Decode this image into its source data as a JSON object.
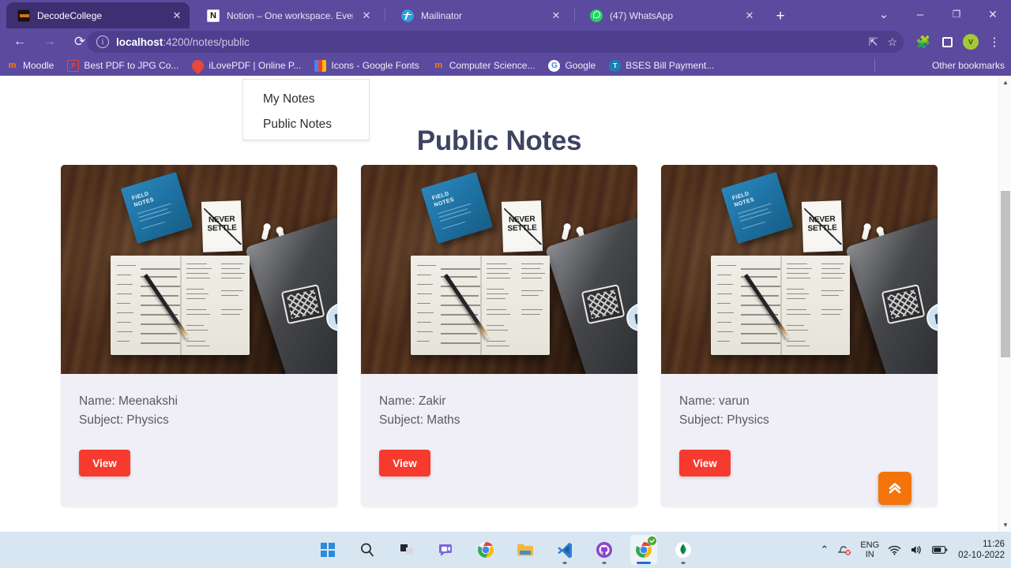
{
  "browser": {
    "tabs": [
      {
        "title": "DecodeCollege",
        "active": true,
        "favicon": "decodecollege-icon",
        "close_label": "✕"
      },
      {
        "title": "Notion – One workspace. Every t",
        "active": false,
        "favicon": "notion-icon",
        "close_label": "✕"
      },
      {
        "title": "Mailinator",
        "active": false,
        "favicon": "mailinator-icon",
        "close_label": "✕"
      },
      {
        "title": "(47) WhatsApp",
        "active": false,
        "favicon": "whatsapp-icon",
        "close_label": "✕"
      }
    ],
    "new_tab_label": "+",
    "window_controls": {
      "tab_search": "⌄",
      "minimize": "–",
      "maximize": "❐",
      "close": "✕"
    },
    "nav": {
      "back": "←",
      "forward": "→",
      "reload": "⟳"
    },
    "omnibox": {
      "info_label": "i",
      "url_host": "localhost",
      "url_path": ":4200/notes/public",
      "full_url": "localhost:4200/notes/public",
      "share_icon": "share-icon",
      "bookmark_icon": "star-icon"
    },
    "toolbar_icons": {
      "extensions": "puzzle-icon",
      "side_panel": "side-panel-icon",
      "profile_initial": "v",
      "menu": "⋮"
    },
    "bookmarks": [
      {
        "label": "Moodle",
        "icon": "moodle-icon",
        "color": "#f98012"
      },
      {
        "label": "Best PDF to JPG Co...",
        "icon": "pdf-icon",
        "color": "#e8483c"
      },
      {
        "label": "iLovePDF | Online P...",
        "icon": "ilovepdf-icon",
        "color": "#e8483c"
      },
      {
        "label": "Icons - Google Fonts",
        "icon": "google-fonts-icon",
        "color": "#fbbc04"
      },
      {
        "label": "Computer Science...",
        "icon": "moodle-icon",
        "color": "#f98012"
      },
      {
        "label": "Google",
        "icon": "google-icon",
        "color": "#4285f4"
      },
      {
        "label": "BSES Bill Payment...",
        "icon": "bses-icon",
        "color": "#1a7fb5"
      }
    ],
    "other_bookmarks": {
      "label": "Other bookmarks",
      "icon": "folder-icon"
    }
  },
  "page": {
    "title": "Public Notes",
    "dropdown": {
      "items": [
        {
          "label": "My Notes"
        },
        {
          "label": "Public Notes"
        }
      ]
    },
    "notes": [
      {
        "name_label": "Name: Meenakshi",
        "subject_label": "Subject: Physics",
        "button_label": "View",
        "image_alt": "desk-notebook-photo"
      },
      {
        "name_label": "Name: Zakir",
        "subject_label": "Subject: Maths",
        "button_label": "View",
        "image_alt": "desk-notebook-photo"
      },
      {
        "name_label": "Name: varun",
        "subject_label": "Subject: Physics",
        "button_label": "View",
        "image_alt": "desk-notebook-photo"
      }
    ],
    "photo_text": {
      "field_notes": "FIELD\nNOTES",
      "never_settle": "NEVER\nSETTLE"
    },
    "scroll_top_button": {
      "icon": "double-chevron-up-icon",
      "color": "#f2740b"
    },
    "scrollbar": {
      "up_arrow": "▲",
      "down_arrow": "▼"
    }
  },
  "taskbar": {
    "apps": [
      {
        "name": "start-button",
        "icon": "windows-icon"
      },
      {
        "name": "search-button",
        "icon": "search-icon"
      },
      {
        "name": "task-view-button",
        "icon": "task-view-icon"
      },
      {
        "name": "chat-button",
        "icon": "chat-icon"
      },
      {
        "name": "chrome-button",
        "icon": "chrome-icon"
      },
      {
        "name": "file-explorer-button",
        "icon": "folder-icon"
      },
      {
        "name": "vscode-button",
        "icon": "vscode-icon"
      },
      {
        "name": "github-desktop-button",
        "icon": "github-icon"
      },
      {
        "name": "chrome-active-button",
        "icon": "chrome-icon"
      },
      {
        "name": "mongodb-compass-button",
        "icon": "mongodb-icon"
      }
    ],
    "tray": {
      "overflow": "⌃",
      "mute_icon": "notification-mute-icon",
      "language_line1": "ENG",
      "language_line2": "IN",
      "wifi_icon": "wifi-icon",
      "volume_icon": "volume-icon",
      "battery_icon": "battery-icon",
      "time": "11:26",
      "date": "02-10-2022"
    }
  },
  "colors": {
    "browser_purple": "#5b4a9e",
    "active_tab": "#3d2f72",
    "heading": "#3e4362",
    "card_bg": "#f0eff5",
    "view_button": "#f63a2e",
    "scroll_top": "#f2740b",
    "taskbar": "#d8e6f2"
  }
}
